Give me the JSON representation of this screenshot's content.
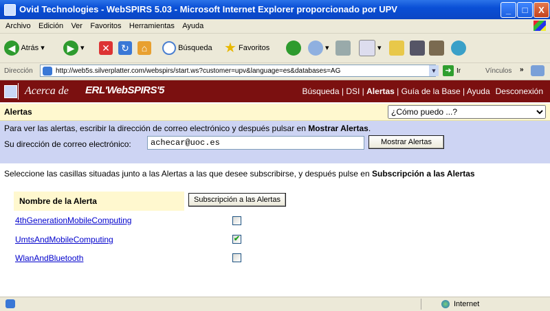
{
  "window": {
    "title": "Ovid Technologies - WebSPIRS 5.03 - Microsoft Internet Explorer proporcionado por UPV",
    "min": "_",
    "max": "□",
    "close": "X"
  },
  "menubar": [
    "Archivo",
    "Edición",
    "Ver",
    "Favoritos",
    "Herramientas",
    "Ayuda"
  ],
  "toolbar": {
    "back": "Atrás",
    "back_arrow": "◀",
    "forward_arrow": "▶",
    "stop": "✕",
    "refresh": "↻",
    "home": "⌂",
    "search": "Búsqueda",
    "favorites": "Favoritos"
  },
  "addressbar": {
    "label": "Dirección",
    "url": "http://web5s.silverplatter.com/webspirs/start.ws?customer=upv&language=es&databases=AG",
    "go": "Ir",
    "links": "Vínculos",
    "chevron": "»"
  },
  "banner": {
    "acerca": "Acerca de",
    "brand": "ERL'WebSPIRS'5",
    "nav": {
      "busqueda": "Búsqueda",
      "dsi": "DSI",
      "alertas": "Alertas",
      "guia": "Guía de la Base",
      "ayuda": "Ayuda",
      "desconexion": "Desconexión",
      "sep": " | "
    }
  },
  "page": {
    "title": "Alertas",
    "help_select": "¿Cómo puedo ...?",
    "instructions_pre": "Para ver las alertas, escribir la dirección de correo electrónico y después pulsar en ",
    "instructions_bold": "Mostrar Alertas",
    "instructions_post": ".",
    "email_label": "Su dirección de correo electrónico:",
    "email_value": "achecar@uoc.es",
    "show_alerts_button": "Mostrar Alertas",
    "subscribe_text_pre": "Seleccione las casillas situadas junto a las Alertas a las que desee subscribirse, y después pulse en ",
    "subscribe_text_bold": "Subscripción a las Alertas",
    "column_header": "Nombre de la Alerta",
    "subscribe_button": "Subscripción a las Alertas",
    "alerts": [
      {
        "name": "4thGenerationMobileComputing",
        "checked": false
      },
      {
        "name": "UmtsAndMobileComputing",
        "checked": true
      },
      {
        "name": "WlanAndBluetooth",
        "checked": false
      }
    ],
    "checkmark": "✔"
  },
  "statusbar": {
    "zone": "Internet"
  },
  "colors": {
    "banner": "#7b1010",
    "header_yellow": "#fff8cf",
    "panel_blue": "#cdd4f3",
    "link": "#0000cc"
  }
}
